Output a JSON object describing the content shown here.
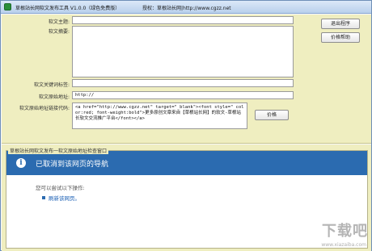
{
  "window": {
    "title": "草根站长网软文发布工具 V1.0.0（绿色免费版）",
    "authorization": "授权：草根站长网|http://www.cgzz.net"
  },
  "form": {
    "subject_label": "软文主题:",
    "subject_value": "",
    "summary_label": "软文摘要:",
    "summary_value": "",
    "keywords_label": "软文关键词标签:",
    "keywords_value": "",
    "source_url_label": "软文原始地址:",
    "source_url_value": "http://",
    "source_code_label": "软文原始地址链接代码:",
    "source_code_value": "<a href=\"http://www.cgzz.net\" target=\"_blank\"><font style=\" color:red; font-weight:bold\">更多原创文章来自【草根站长网】的软文-草根站长软文交流推广平台</font></a>"
  },
  "buttons": {
    "exit": "退出程序",
    "help": "价格帮助",
    "publish": "价格"
  },
  "browser_panel": {
    "group_label": "草根站长网软文发布一软文原始地址检查窗口",
    "nav_title": "已取消到该网页的导航",
    "hint": "您可以尝试以下操作:",
    "refresh_link": "刷新该网页。"
  },
  "watermark": {
    "main": "下载吧",
    "sub": "www.xiazaiba.com"
  }
}
